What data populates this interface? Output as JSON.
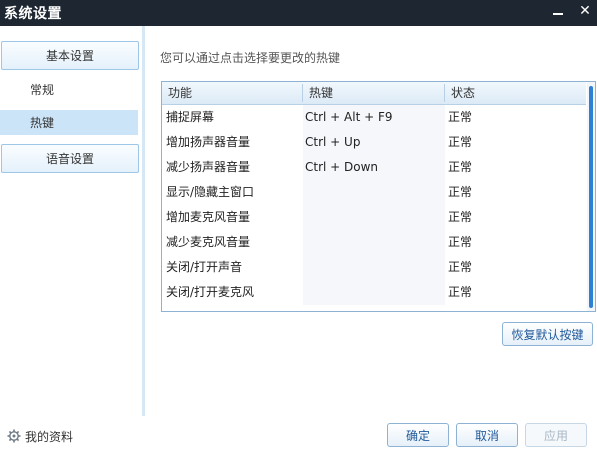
{
  "window": {
    "title": "系统设置",
    "minimize_glyph": "—",
    "close_glyph": "✕"
  },
  "sidebar": {
    "basic_label": "基本设置",
    "sub_general": "常规",
    "sub_hotkeys": "热键",
    "voice_label": "语音设置"
  },
  "main": {
    "hint": "您可以通过点击选择要更改的热键",
    "columns": {
      "function": "功能",
      "hotkey": "热键",
      "status": "状态"
    },
    "rows": [
      {
        "function": "捕捉屏幕",
        "hotkey": "Ctrl + Alt + F9",
        "status": "正常"
      },
      {
        "function": "增加扬声器音量",
        "hotkey": "Ctrl + Up",
        "status": "正常"
      },
      {
        "function": "减少扬声器音量",
        "hotkey": "Ctrl + Down",
        "status": "正常"
      },
      {
        "function": "显示/隐藏主窗口",
        "hotkey": "",
        "status": "正常"
      },
      {
        "function": "增加麦克风音量",
        "hotkey": "",
        "status": "正常"
      },
      {
        "function": "减少麦克风音量",
        "hotkey": "",
        "status": "正常"
      },
      {
        "function": "关闭/打开声音",
        "hotkey": "",
        "status": "正常"
      },
      {
        "function": "关闭/打开麦克风",
        "hotkey": "",
        "status": "正常"
      }
    ],
    "restore_default": "恢复默认按键"
  },
  "footer": {
    "profile_label": "我的资料",
    "profile_icon": "gear-icon",
    "ok": "确定",
    "cancel": "取消",
    "apply": "应用"
  },
  "colors": {
    "titlebar": "#1d2631",
    "selected_item": "#cce4f7",
    "accent_blue": "#2f7fd4"
  }
}
